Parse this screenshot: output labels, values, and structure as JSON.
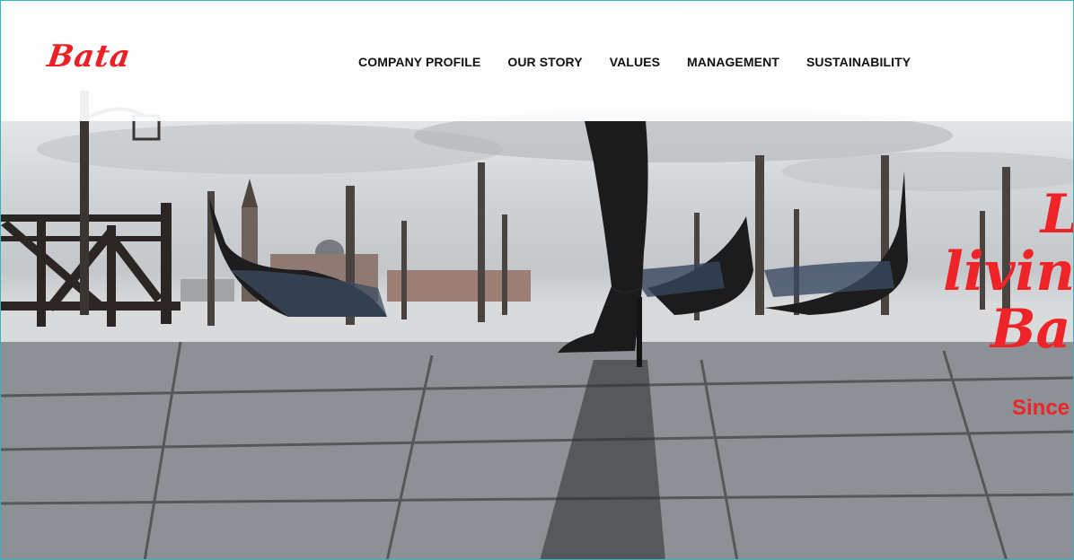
{
  "brand": {
    "logo_text": "Bata",
    "accent_color": "#ec2024"
  },
  "nav": {
    "items": [
      {
        "label": "COMPANY PROFILE"
      },
      {
        "label": "OUR STORY"
      },
      {
        "label": "VALUES"
      },
      {
        "label": "MANAGEMENT"
      },
      {
        "label": "SUSTAINABILITY"
      }
    ]
  },
  "hero": {
    "tagline_lines": [
      "Lo",
      "living",
      "Bata"
    ],
    "since_text": "Since"
  }
}
